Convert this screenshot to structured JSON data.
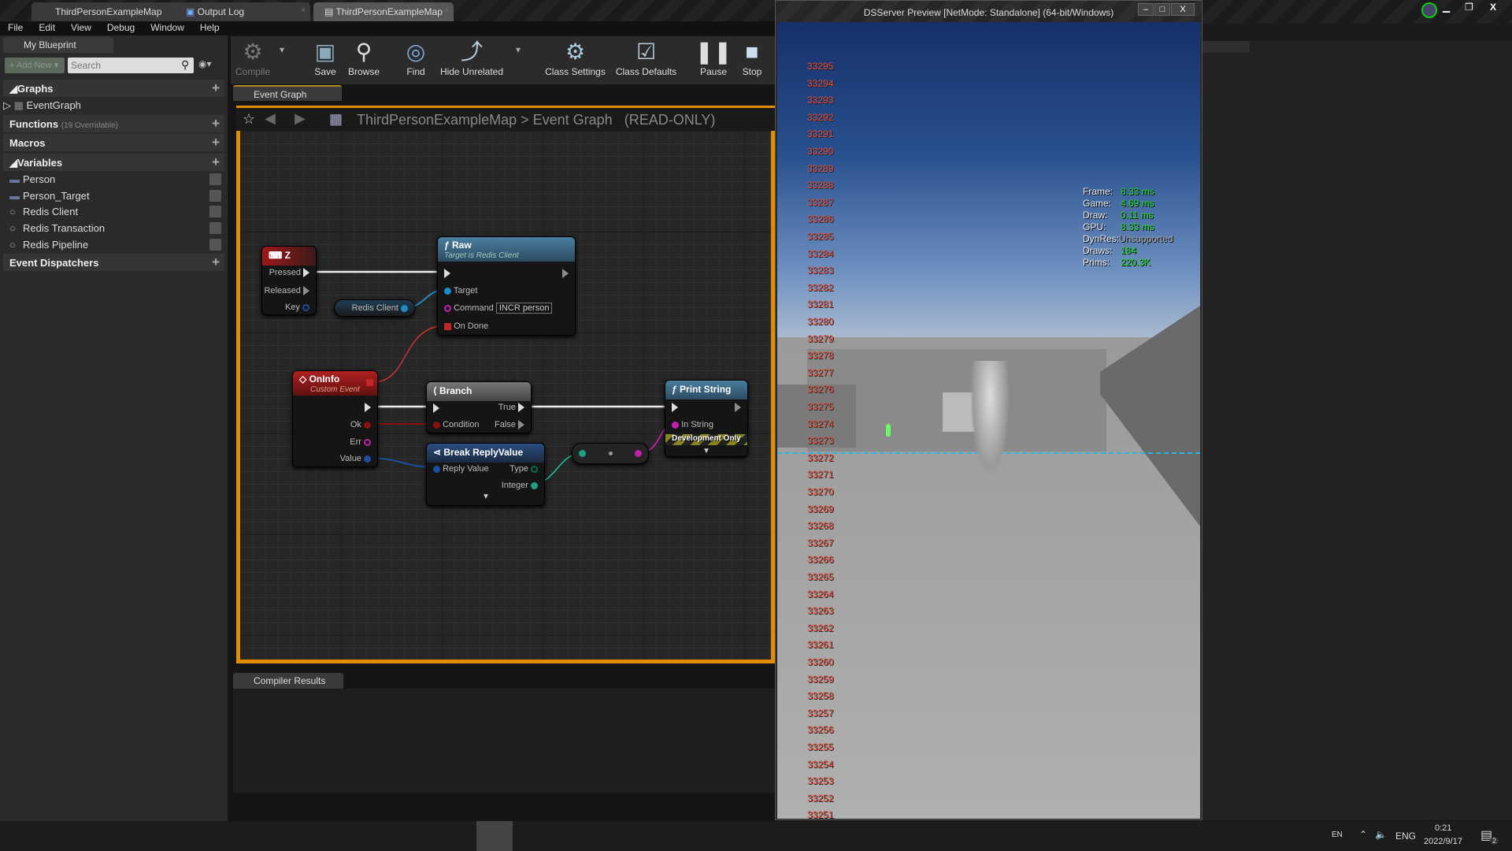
{
  "tabs": [
    {
      "label": "ThirdPersonExampleMap",
      "active": false
    },
    {
      "label": "Output Log",
      "active": false
    },
    {
      "label": "ThirdPersonExampleMap",
      "active": true
    }
  ],
  "menu": [
    "File",
    "Edit",
    "View",
    "Debug",
    "Window",
    "Help"
  ],
  "my_blueprint": {
    "title": "My Blueprint",
    "add_new": "Add New",
    "search_placeholder": "Search",
    "sections": {
      "graphs": "Graphs",
      "event_graph": "EventGraph",
      "functions": "Functions",
      "functions_note": "(19 Overridable)",
      "macros": "Macros",
      "variables": "Variables",
      "dispatchers": "Event Dispatchers"
    },
    "variables": [
      {
        "name": "Person",
        "type": "struct"
      },
      {
        "name": "Person_Target",
        "type": "struct"
      },
      {
        "name": "Redis Client",
        "type": "object"
      },
      {
        "name": "Redis Transaction",
        "type": "object"
      },
      {
        "name": "Redis Pipeline",
        "type": "object"
      }
    ]
  },
  "toolbar": {
    "compile": "Compile",
    "save": "Save",
    "browse": "Browse",
    "find": "Find",
    "hide_unrelated": "Hide Unrelated",
    "class_settings": "Class Settings",
    "class_defaults": "Class Defaults",
    "pause": "Pause",
    "stop": "Stop"
  },
  "graph_tab": "Event Graph",
  "breadcrumb": {
    "map": "ThirdPersonExampleMap",
    "sep": ">",
    "graph": "Event Graph",
    "mode": "(READ-ONLY)"
  },
  "nodes": {
    "z": {
      "title": "Z",
      "pressed": "Pressed",
      "released": "Released",
      "key": "Key"
    },
    "redis_client": "Redis Client",
    "raw": {
      "title": "Raw",
      "subtitle": "Target is Redis Client",
      "target": "Target",
      "command": "Command",
      "command_value": "INCR person",
      "on_done": "On Done"
    },
    "oninfo": {
      "title": "OnInfo",
      "subtitle": "Custom Event",
      "ok": "Ok",
      "err": "Err",
      "value": "Value"
    },
    "branch": {
      "title": "Branch",
      "condition": "Condition",
      "true": "True",
      "false": "False"
    },
    "break": {
      "title": "Break ReplyValue",
      "reply_value": "Reply Value",
      "type": "Type",
      "integer": "Integer"
    },
    "print": {
      "title": "Print String",
      "in_string": "In String",
      "dev_only": "Development Only"
    }
  },
  "compiler_tab": "Compiler Results",
  "preview": {
    "title": "DSServer Preview [NetMode: Standalone]  (64-bit/Windows)",
    "numbers": [
      "33295",
      "33294",
      "33293",
      "33292",
      "33291",
      "33290",
      "33289",
      "33288",
      "33287",
      "33286",
      "33285",
      "33284",
      "33283",
      "33282",
      "33281",
      "33280",
      "33279",
      "33278",
      "33277",
      "33276",
      "33275",
      "33274",
      "33273",
      "33272",
      "33271",
      "33270",
      "33269",
      "33268",
      "33267",
      "33266",
      "33265",
      "33264",
      "33263",
      "33262",
      "33261",
      "33260",
      "33259",
      "33258",
      "33257",
      "33256",
      "33255",
      "33254",
      "33253",
      "33252",
      "33251"
    ],
    "stats": [
      {
        "label": "Frame:",
        "value": "8.33 ms"
      },
      {
        "label": "Game:",
        "value": "4.69 ms"
      },
      {
        "label": "Draw:",
        "value": "0.11 ms"
      },
      {
        "label": "GPU:",
        "value": "8.33 ms"
      },
      {
        "label": "DynRes:",
        "value": "Unsupported"
      },
      {
        "label": "Draws:",
        "value": "184"
      },
      {
        "label": "Prims:",
        "value": "220.3K"
      }
    ]
  },
  "taskbar": {
    "ime": "EN",
    "lang": "ENG",
    "time": "0:21",
    "date": "2022/9/17",
    "notifications": "2"
  },
  "colors": {
    "accent": "#e28c00",
    "number_red": "#e84a36",
    "stat_green": "#1fe01f"
  }
}
